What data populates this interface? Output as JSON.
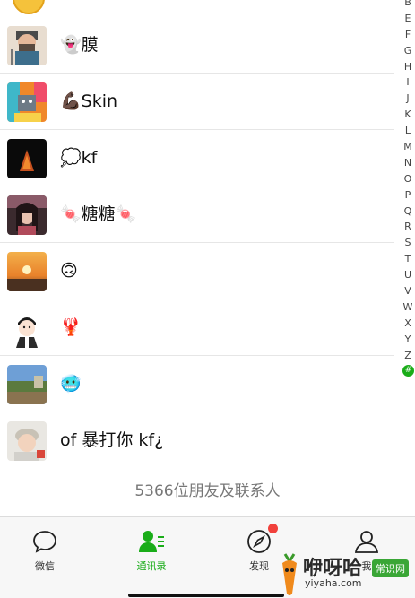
{
  "contacts": [
    {
      "name": "👻膜",
      "avatar": "avatar-cartoon-man"
    },
    {
      "name": "💪🏿Skin",
      "avatar": "avatar-colorful-cat"
    },
    {
      "name": "💭kf",
      "avatar": "avatar-dark-flame"
    },
    {
      "name": "🍬糖糖🍬",
      "avatar": "avatar-girl-photo"
    },
    {
      "name": "🙃",
      "avatar": "avatar-sunset"
    },
    {
      "name": "🦞",
      "avatar": "avatar-cartoon-boy"
    },
    {
      "name": "🥶",
      "avatar": "avatar-landscape"
    },
    {
      "name": "of 暴打你 kf¿",
      "avatar": "avatar-baby-photo"
    }
  ],
  "index_letters": [
    "B",
    "E",
    "F",
    "G",
    "H",
    "I",
    "J",
    "K",
    "L",
    "M",
    "N",
    "O",
    "P",
    "Q",
    "R",
    "S",
    "T",
    "U",
    "V",
    "W",
    "X",
    "Y",
    "Z"
  ],
  "index_hash": "#",
  "footer": {
    "count_text": "5366位朋友及联系人"
  },
  "tabs": [
    {
      "label": "微信",
      "icon": "chat-bubble-icon"
    },
    {
      "label": "通讯录",
      "icon": "contacts-icon"
    },
    {
      "label": "发现",
      "icon": "compass-icon"
    },
    {
      "label": "我",
      "icon": "person-icon"
    }
  ],
  "watermark": {
    "brand": "咿呀哈",
    "site": "yiyaha.com",
    "badge": "常识网"
  },
  "colors": {
    "accent": "#1aad19",
    "badge_red": "#f1413c"
  }
}
